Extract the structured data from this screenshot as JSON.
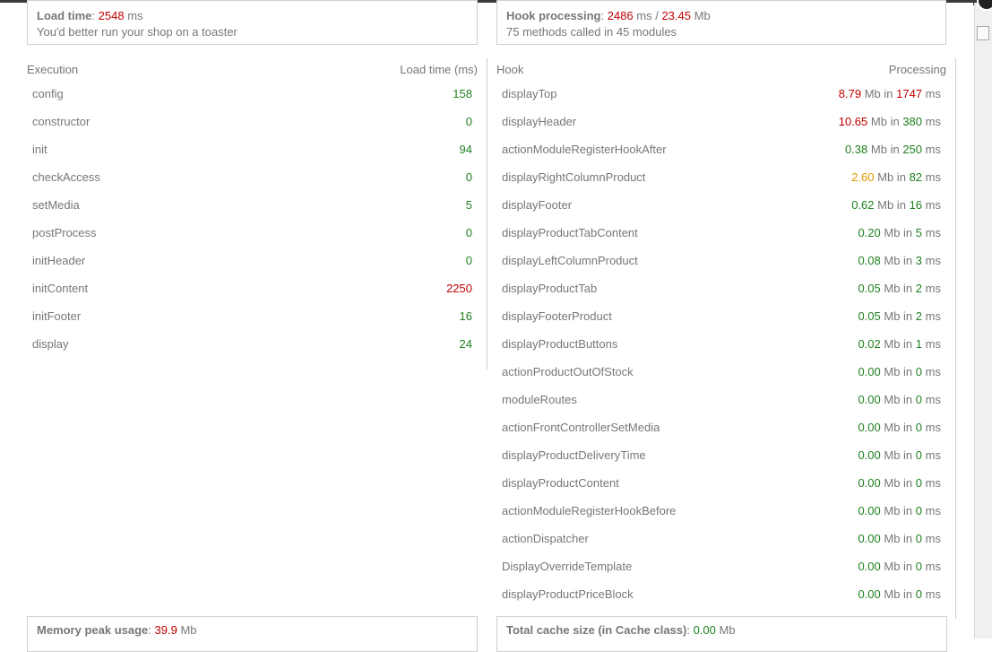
{
  "summary": {
    "load_time_label": "Load time",
    "load_time_value": "2548",
    "load_time_unit": "ms",
    "load_time_note": "You'd better run your shop on a toaster",
    "hook_label": "Hook processing",
    "hook_ms": "2486",
    "hook_ms_unit": "ms /",
    "hook_mb": "23.45",
    "hook_mb_unit": "Mb",
    "hook_note": "75 methods called in 45 modules"
  },
  "execution": {
    "header_left": "Execution",
    "header_right": "Load time (ms)",
    "rows": [
      {
        "name": "config",
        "value": "158",
        "status": "green"
      },
      {
        "name": "constructor",
        "value": "0",
        "status": "green"
      },
      {
        "name": "init",
        "value": "94",
        "status": "green"
      },
      {
        "name": "checkAccess",
        "value": "0",
        "status": "green"
      },
      {
        "name": "setMedia",
        "value": "5",
        "status": "green"
      },
      {
        "name": "postProcess",
        "value": "0",
        "status": "green"
      },
      {
        "name": "initHeader",
        "value": "0",
        "status": "green"
      },
      {
        "name": "initContent",
        "value": "2250",
        "status": "red"
      },
      {
        "name": "initFooter",
        "value": "16",
        "status": "green"
      },
      {
        "name": "display",
        "value": "24",
        "status": "green"
      }
    ]
  },
  "hooks": {
    "header_left": "Hook",
    "header_right": "Processing",
    "mb_in": "Mb in",
    "ms": "ms",
    "rows": [
      {
        "name": "displayTop",
        "mb": "8.79",
        "mb_status": "red",
        "ms": "1747",
        "ms_status": "red"
      },
      {
        "name": "displayHeader",
        "mb": "10.65",
        "mb_status": "red",
        "ms": "380",
        "ms_status": "green"
      },
      {
        "name": "actionModuleRegisterHookAfter",
        "mb": "0.38",
        "mb_status": "green",
        "ms": "250",
        "ms_status": "green"
      },
      {
        "name": "displayRightColumnProduct",
        "mb": "2.60",
        "mb_status": "orange",
        "ms": "82",
        "ms_status": "green"
      },
      {
        "name": "displayFooter",
        "mb": "0.62",
        "mb_status": "green",
        "ms": "16",
        "ms_status": "green"
      },
      {
        "name": "displayProductTabContent",
        "mb": "0.20",
        "mb_status": "green",
        "ms": "5",
        "ms_status": "green"
      },
      {
        "name": "displayLeftColumnProduct",
        "mb": "0.08",
        "mb_status": "green",
        "ms": "3",
        "ms_status": "green"
      },
      {
        "name": "displayProductTab",
        "mb": "0.05",
        "mb_status": "green",
        "ms": "2",
        "ms_status": "green"
      },
      {
        "name": "displayFooterProduct",
        "mb": "0.05",
        "mb_status": "green",
        "ms": "2",
        "ms_status": "green"
      },
      {
        "name": "displayProductButtons",
        "mb": "0.02",
        "mb_status": "green",
        "ms": "1",
        "ms_status": "green"
      },
      {
        "name": "actionProductOutOfStock",
        "mb": "0.00",
        "mb_status": "green",
        "ms": "0",
        "ms_status": "green"
      },
      {
        "name": "moduleRoutes",
        "mb": "0.00",
        "mb_status": "green",
        "ms": "0",
        "ms_status": "green"
      },
      {
        "name": "actionFrontControllerSetMedia",
        "mb": "0.00",
        "mb_status": "green",
        "ms": "0",
        "ms_status": "green"
      },
      {
        "name": "displayProductDeliveryTime",
        "mb": "0.00",
        "mb_status": "green",
        "ms": "0",
        "ms_status": "green"
      },
      {
        "name": "displayProductContent",
        "mb": "0.00",
        "mb_status": "green",
        "ms": "0",
        "ms_status": "green"
      },
      {
        "name": "actionModuleRegisterHookBefore",
        "mb": "0.00",
        "mb_status": "green",
        "ms": "0",
        "ms_status": "green"
      },
      {
        "name": "actionDispatcher",
        "mb": "0.00",
        "mb_status": "green",
        "ms": "0",
        "ms_status": "green"
      },
      {
        "name": "DisplayOverrideTemplate",
        "mb": "0.00",
        "mb_status": "green",
        "ms": "0",
        "ms_status": "green"
      },
      {
        "name": "displayProductPriceBlock",
        "mb": "0.00",
        "mb_status": "green",
        "ms": "0",
        "ms_status": "green"
      }
    ]
  },
  "footer": {
    "memory_label": "Memory peak usage",
    "memory_value": "39.9",
    "memory_unit": "Mb",
    "cache_label": "Total cache size (in Cache class)",
    "cache_value": "0.00",
    "cache_unit": "Mb"
  },
  "colors": {
    "red": "#c00000",
    "green": "#208020",
    "orange": "#e09a00",
    "border": "#cfcfcf",
    "text": "#777777"
  }
}
